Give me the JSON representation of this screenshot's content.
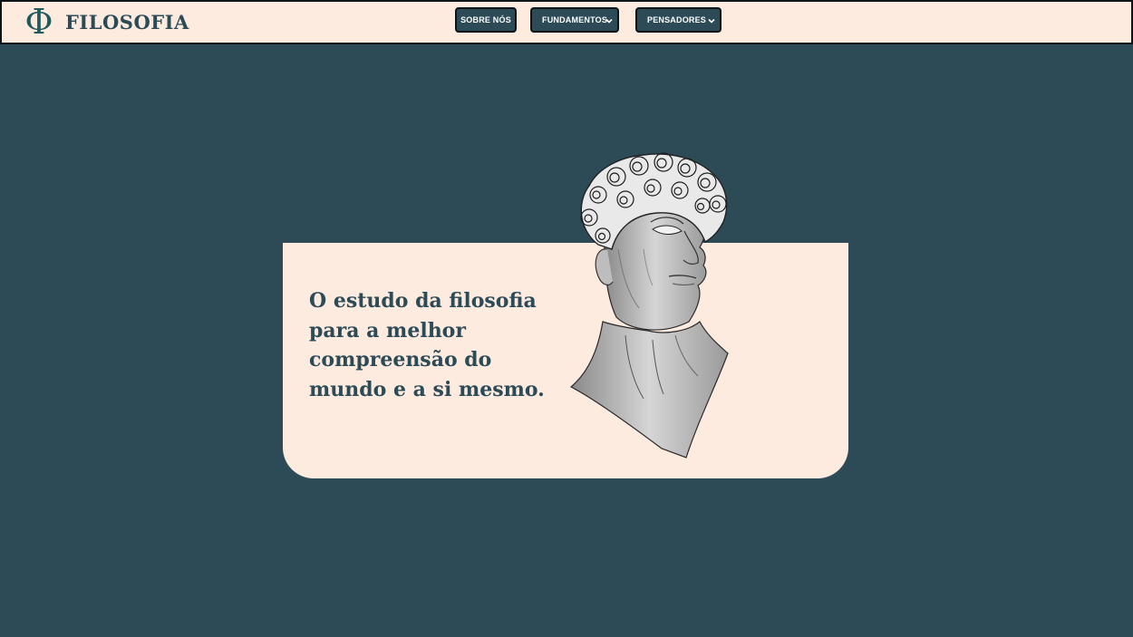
{
  "header": {
    "logo_symbol": "Φ",
    "logo_text": "FILOSOFIA",
    "nav": [
      {
        "label": "SOBRE NÓS",
        "has_dropdown": false
      },
      {
        "label": "FUNDAMENTOS",
        "has_dropdown": true
      },
      {
        "label": "PENSADORES",
        "has_dropdown": true
      }
    ]
  },
  "hero": {
    "headline": "O estudo da filosofia para a melhor compreensão do mundo e a si mesmo.",
    "image_icon": "greek-bust-sketch"
  },
  "colors": {
    "background": "#2d4a57",
    "cream": "#fdebe0",
    "dark": "#0c1418"
  }
}
